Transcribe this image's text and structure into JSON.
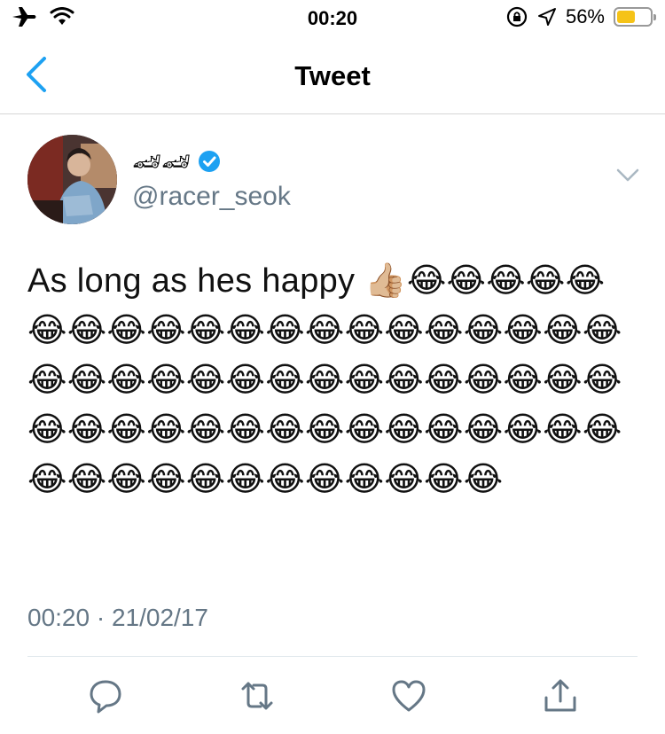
{
  "status_bar": {
    "time": "00:20",
    "battery_percent": "56%",
    "battery_level": 0.56,
    "icons": [
      "airplane-icon",
      "wifi-icon",
      "orientation-lock-icon",
      "location-arrow-icon",
      "battery-icon"
    ]
  },
  "nav": {
    "title": "Tweet",
    "back_icon": "chevron-left-icon"
  },
  "tweet": {
    "display_name": "🏎🏎",
    "verified": true,
    "handle": "@racer_seok",
    "text": "As long as hes happy 👍🏼😂😂😂😂😂😂😂😂😂😂😂😂😂😂😂😂😂😂😂😂😂😂😂😂😂😂😂😂😂😂😂😂😂😂😂😂😂😂😂😂😂😂😂😂😂😂😂😂😂😂😂😂😂😂😂😂😂😂😂😂😂😂",
    "timestamp": "00:20 · 21/02/17"
  },
  "actions": [
    "reply-icon",
    "retweet-icon",
    "like-icon",
    "share-icon"
  ],
  "colors": {
    "link_blue": "#1da1f2",
    "muted_gray": "#657786",
    "battery_yellow": "#f5c318"
  }
}
